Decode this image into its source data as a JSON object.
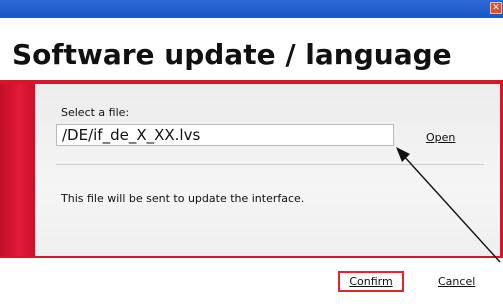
{
  "window": {
    "close_icon": "close-icon",
    "close_glyph": "✕"
  },
  "dialog": {
    "title": "Software update / language",
    "select_label": "Select a file:",
    "file_value": "/DE/if_de_X_XX.lvs",
    "open_label": "Open",
    "info_text": "This file will be sent to update the interface.",
    "confirm_label": "Confirm",
    "cancel_label": "Cancel"
  },
  "colors": {
    "accent_red": "#d7162b",
    "titlebar_blue": "#1b55c6",
    "highlight_red": "#e3262d"
  }
}
